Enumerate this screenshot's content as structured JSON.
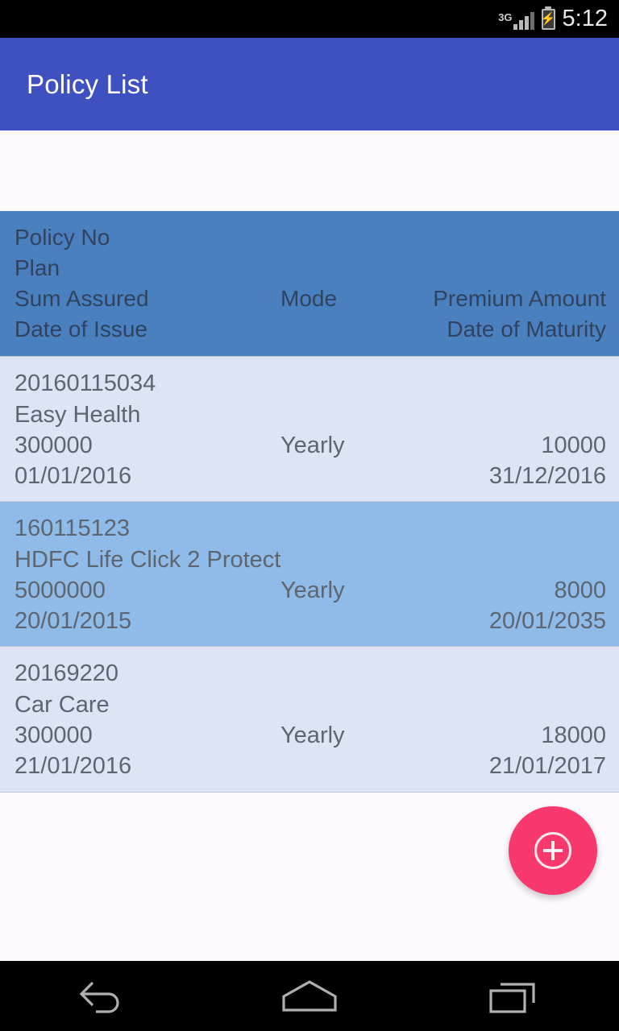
{
  "status_bar": {
    "network_label": "3G",
    "signal_icon": "signal-bars-icon",
    "battery_icon": "battery-charging-icon",
    "time": "5:12"
  },
  "app_bar": {
    "title": "Policy List"
  },
  "table": {
    "header": {
      "policy_no": "Policy No",
      "plan": "Plan",
      "sum_assured": "Sum Assured",
      "mode": "Mode",
      "premium_amount": "Premium Amount",
      "date_of_issue": "Date of Issue",
      "date_of_maturity": "Date of Maturity"
    },
    "rows": [
      {
        "policy_no": "20160115034",
        "plan": "Easy Health",
        "sum_assured": "300000",
        "mode": "Yearly",
        "premium_amount": "10000",
        "date_of_issue": "01/01/2016",
        "date_of_maturity": "31/12/2016",
        "style": "light"
      },
      {
        "policy_no": "160115123",
        "plan": "HDFC Life Click 2 Protect",
        "sum_assured": "5000000",
        "mode": "Yearly",
        "premium_amount": "8000",
        "date_of_issue": "20/01/2015",
        "date_of_maturity": "20/01/2035",
        "style": "dark"
      },
      {
        "policy_no": "20169220",
        "plan": "Car Care",
        "sum_assured": "300000",
        "mode": "Yearly",
        "premium_amount": "18000",
        "date_of_issue": "21/01/2016",
        "date_of_maturity": "21/01/2017",
        "style": "light"
      }
    ]
  },
  "fab": {
    "icon": "add-circle-icon",
    "label": ""
  },
  "nav_bar": {
    "back": "back-icon",
    "home": "home-icon",
    "recents": "recents-icon"
  },
  "colors": {
    "app_bar": "#3f51c0",
    "table_header": "#4a80c0",
    "row_light": "#dde5f4",
    "row_dark": "#8fbbe8",
    "fab": "#f9386e",
    "header_text": "#2f4360",
    "row_text": "#5d6570"
  }
}
